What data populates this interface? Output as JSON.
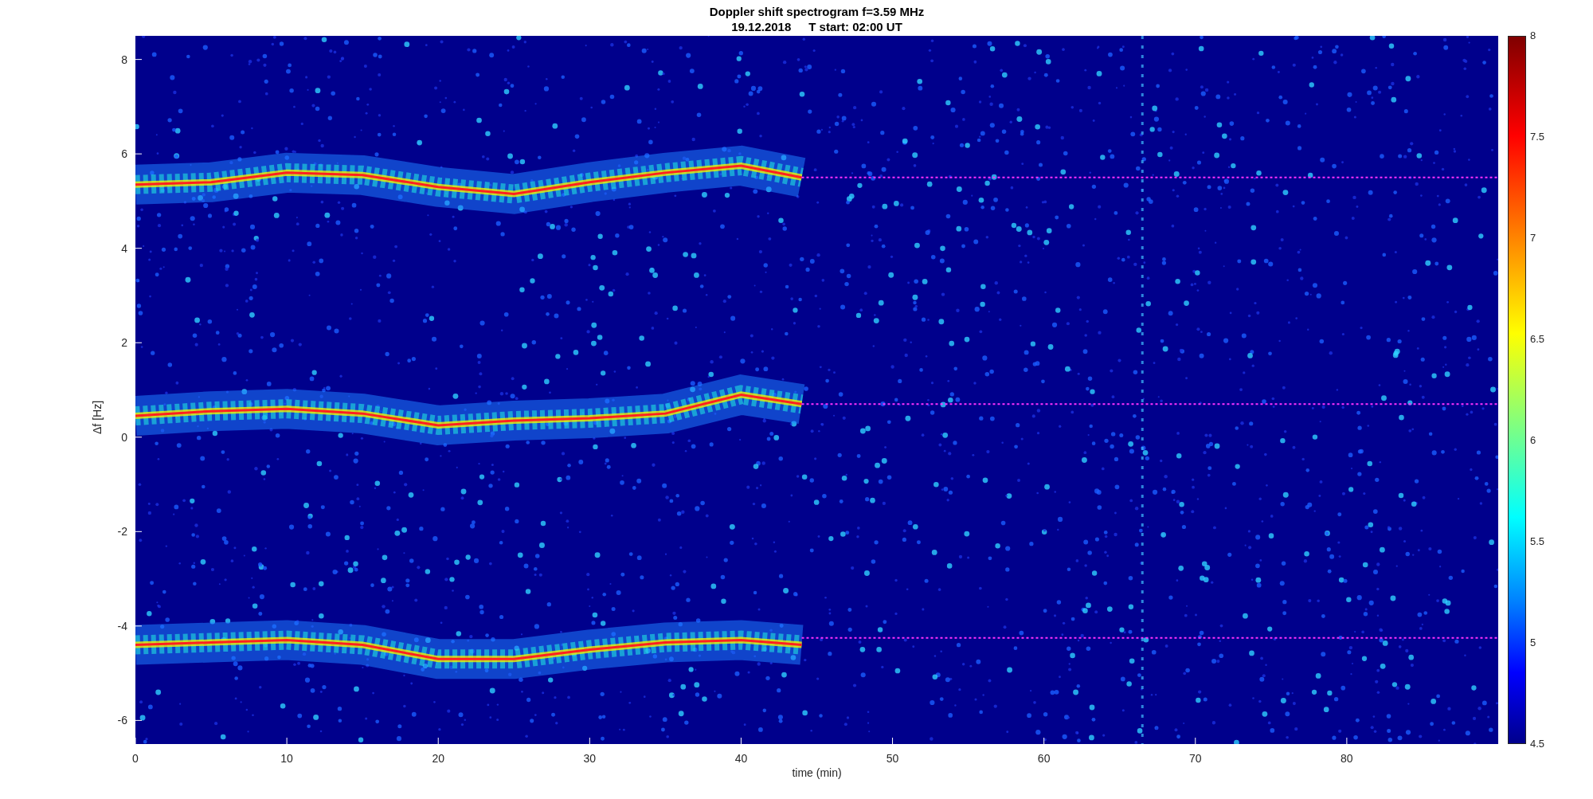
{
  "figure": {
    "title": "Doppler shift spectrogram f=3.59 MHz",
    "subtitle": [
      "19.12.2018",
      "T start: 02:00 UT"
    ]
  },
  "axes": {
    "ylabel": "Δf [Hz]",
    "xlabel": "time (min)",
    "yticks": [
      "8",
      "6",
      "4",
      "2",
      "0",
      "-2",
      "-4",
      "-6"
    ],
    "xticks": [
      "0",
      "10",
      "20",
      "30",
      "40",
      "50",
      "60",
      "70",
      "80"
    ]
  },
  "colorbar": {
    "ticks": [
      "8",
      "7.5",
      "7",
      "6.5",
      "6",
      "5.5",
      "5",
      "4.5"
    ]
  }
}
